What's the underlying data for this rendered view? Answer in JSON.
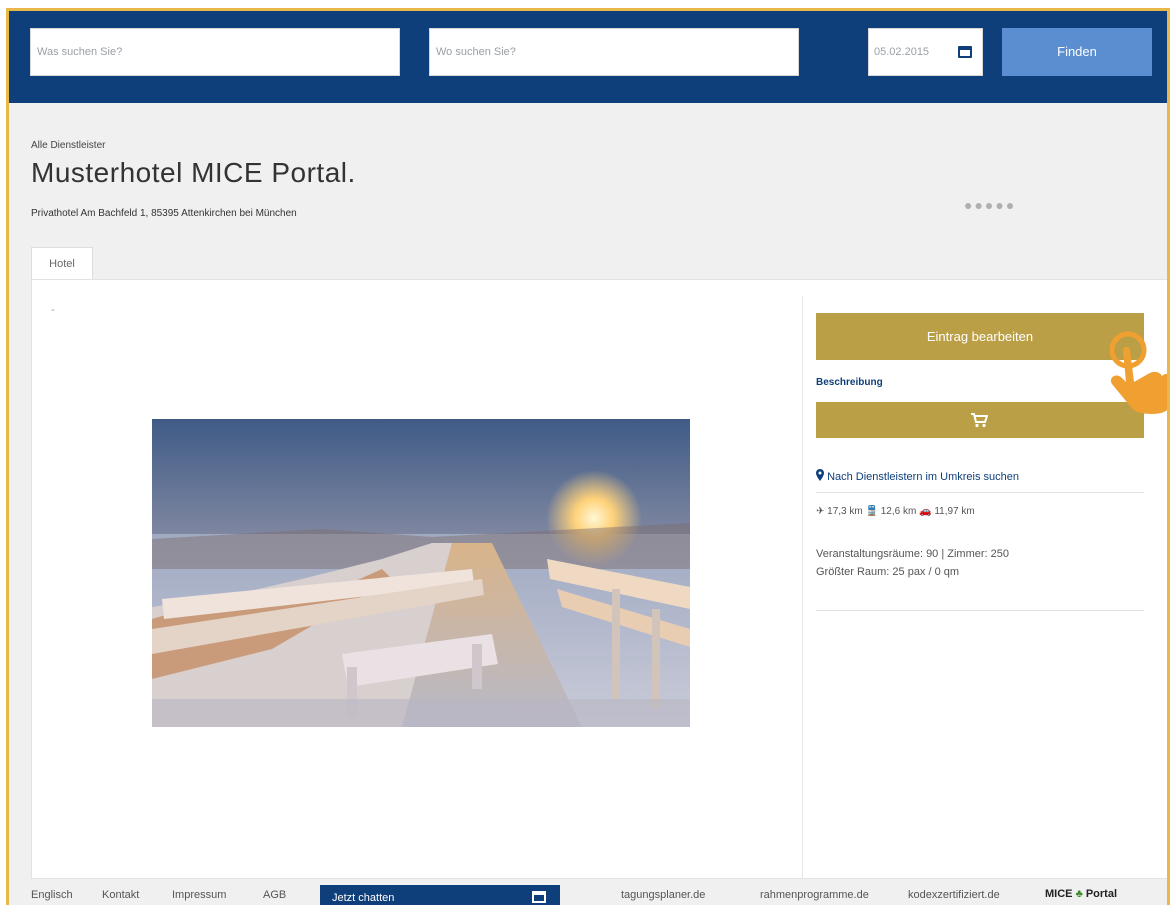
{
  "header": {
    "what_placeholder": "Was suchen Sie?",
    "where_placeholder": "Wo suchen Sie?",
    "date_value": "05.02.2015",
    "find_label": "Finden"
  },
  "breadcrumb": "Alle Dienstleister",
  "hotel": {
    "name": "Musterhotel MICE Portal.",
    "address": "Privathotel Am Bachfeld 1, 85395 Attenkirchen bei München",
    "stars": 5,
    "stars_glyph": "●●●●●"
  },
  "tabs": [
    {
      "label": "Hotel"
    }
  ],
  "content": {
    "dash": "-"
  },
  "sidebar": {
    "edit_label": "Eintrag bearbeiten",
    "description_link": "Beschreibung",
    "nearby_label": "Nach Dienstleistern im Umkreis suchen",
    "distances": "✈ 17,3 km  🚆 12,6 km  🚗 11,97 km",
    "rooms_line": "Veranstaltungsräume: 90 | Zimmer: 250",
    "largest_room": "Größter Raum: 25 pax / 0 qm"
  },
  "footer": {
    "links": [
      "Englisch",
      "Kontakt",
      "Impressum",
      "AGB"
    ],
    "chat_label": "Jetzt chatten",
    "partner_links": [
      "tagungsplaner.de",
      "rahmenprogramme.de",
      "kodexzertifiziert.de"
    ],
    "brand_left": "MICE",
    "brand_right": "Portal"
  },
  "colors": {
    "navy": "#0f3f7a",
    "gold": "#bb9f47",
    "find_blue": "#5a8ed0",
    "frame_orange": "#e8b84a",
    "hand_orange": "#f0a030"
  },
  "icons": [
    "calendar-icon",
    "cart-icon",
    "location-pin-icon",
    "chat-window-icon",
    "pointing-hand-icon"
  ]
}
